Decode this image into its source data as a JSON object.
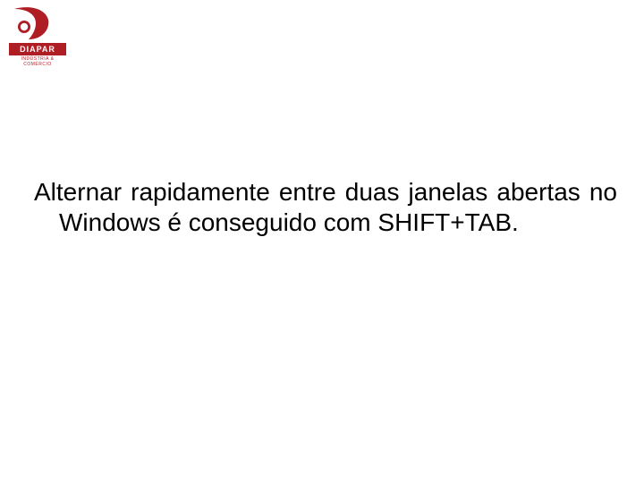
{
  "logo": {
    "name": "DIAPAR",
    "tagline": "INDÚSTRIA & COMÉRCIO"
  },
  "slide": {
    "text": "Alternar rapidamente entre duas janelas abertas no Windows é conseguido com SHIFT+TAB."
  }
}
